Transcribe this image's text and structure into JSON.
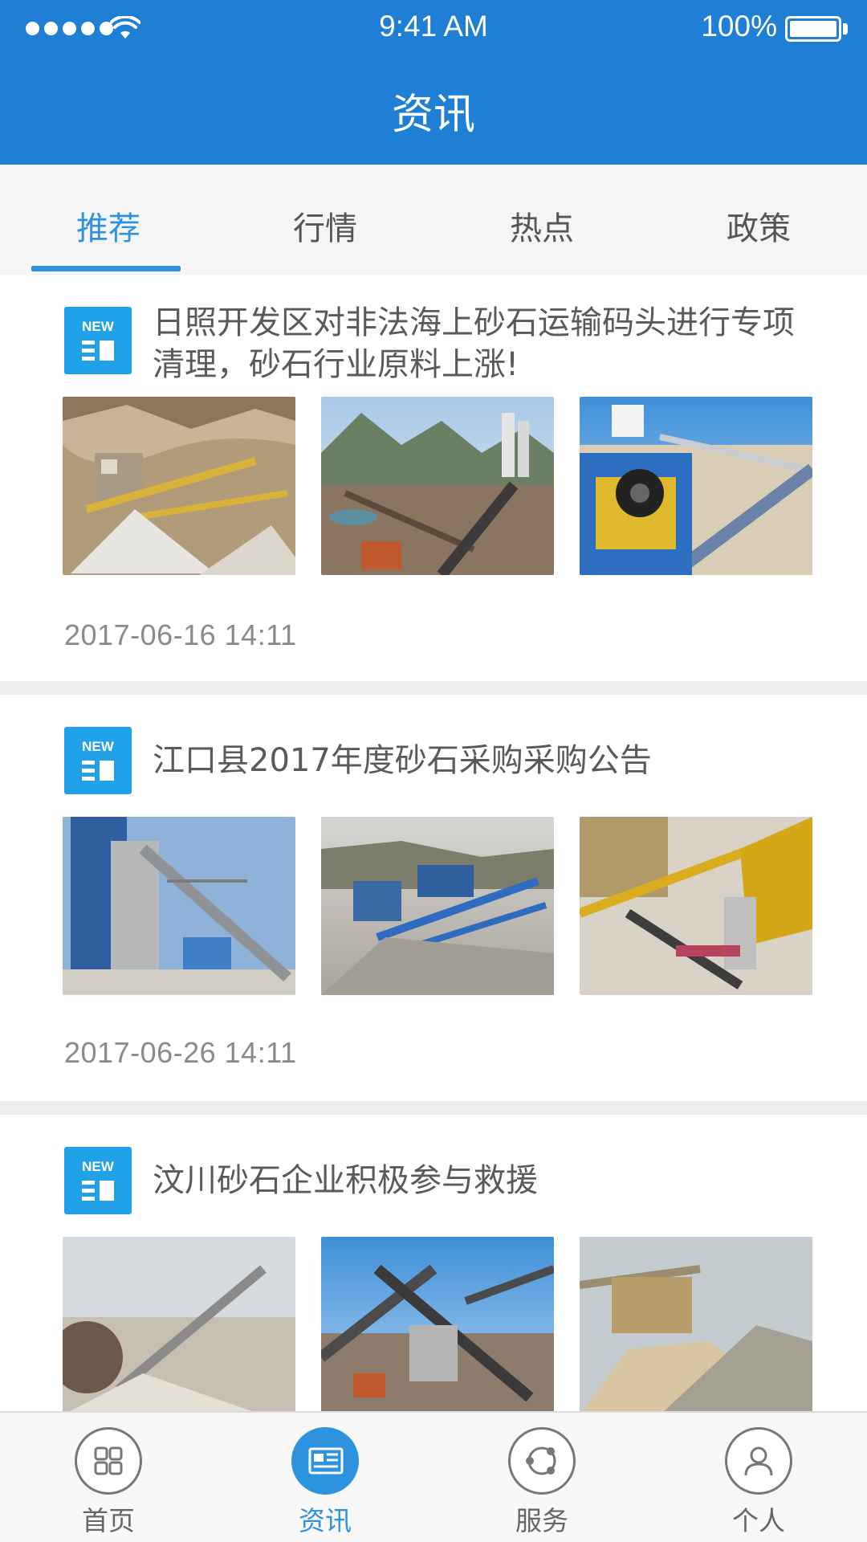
{
  "status_bar": {
    "time": "9:41 AM",
    "battery": "100%",
    "icons": [
      "signal-dots-icon",
      "wifi-icon",
      "battery-icon"
    ]
  },
  "header": {
    "title": "资讯"
  },
  "tabs": [
    {
      "label": "推荐",
      "active": true
    },
    {
      "label": "行情",
      "active": false
    },
    {
      "label": "热点",
      "active": false
    },
    {
      "label": "政策",
      "active": false
    }
  ],
  "news": [
    {
      "badge_icon": "new-badge-icon",
      "badge_text": "NEW",
      "title": "日照开发区对非法海上砂石运输码头进行专项清理，砂石行业原料上涨!",
      "date": "2017-06-16   14:11",
      "images": [
        "quarry-conveyor-photo",
        "mountain-crushing-plant-photo",
        "jaw-crusher-conveyor-photo"
      ]
    },
    {
      "badge_icon": "new-badge-icon",
      "badge_text": "NEW",
      "title": "江口县2017年度砂石采购采购公告",
      "date": "2017-06-26   14:11",
      "images": [
        "blue-sand-plant-photo",
        "blue-conveyor-stockpile-photo",
        "yellow-cone-crusher-photo"
      ]
    },
    {
      "badge_icon": "new-badge-icon",
      "badge_text": "NEW",
      "title": "汶川砂石企业积极参与救援",
      "date": "",
      "images": [
        "sand-washer-conveyor-photo",
        "multi-conveyor-plant-photo",
        "gravel-pile-photo"
      ]
    }
  ],
  "bottom_nav": [
    {
      "label": "首页",
      "icon": "grid-icon",
      "active": false
    },
    {
      "label": "资讯",
      "icon": "news-icon",
      "active": true
    },
    {
      "label": "服务",
      "icon": "service-icon",
      "active": false
    },
    {
      "label": "个人",
      "icon": "person-icon",
      "active": false
    }
  ],
  "colors": {
    "brand_blue": "#1f7fd4",
    "accent_blue": "#2d93df",
    "badge_blue": "#21a1e8"
  }
}
